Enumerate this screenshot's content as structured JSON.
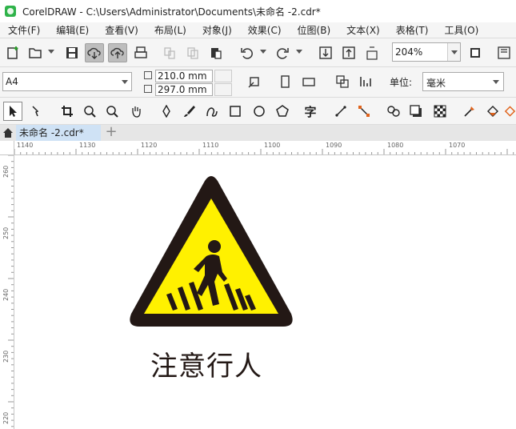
{
  "window": {
    "title": "CorelDRAW - C:\\Users\\Administrator\\Documents\\未命名 -2.cdr*"
  },
  "menu": [
    "文件(F)",
    "编辑(E)",
    "查看(V)",
    "布局(L)",
    "对象(J)",
    "效果(C)",
    "位图(B)",
    "文本(X)",
    "表格(T)",
    "工具(O)"
  ],
  "toolbar": {
    "zoom": "204%"
  },
  "property_bar": {
    "paper_size": "A4",
    "width": "210.0 mm",
    "height": "297.0 mm",
    "unit_label": "单位:",
    "unit_value": "毫米"
  },
  "tabs": {
    "document": "未命名 -2.cdr*",
    "add": "+"
  },
  "rulers": {
    "horizontal": [
      "1140",
      "1130",
      "1120",
      "1110",
      "1100",
      "1090",
      "1080",
      "1070"
    ],
    "vertical": [
      "260",
      "250",
      "240",
      "230",
      "220"
    ]
  },
  "canvas": {
    "sign_caption": "注意行人",
    "sign_colors": {
      "border": "#231815",
      "fill": "#fff100"
    }
  },
  "colors": {
    "tab_active": "#cfe2f5",
    "selection_bg": "#bdbdbd"
  }
}
